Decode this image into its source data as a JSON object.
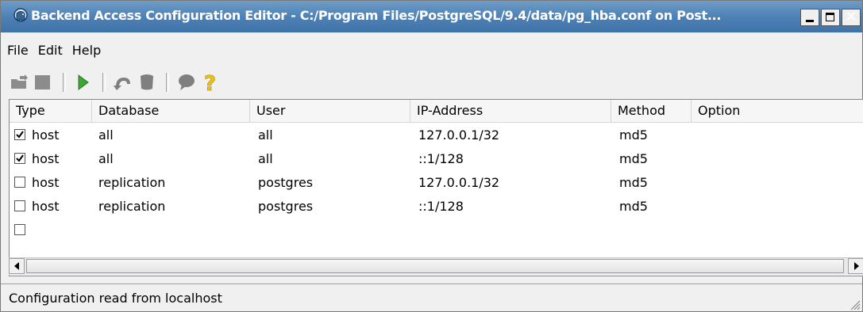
{
  "window": {
    "title": "Backend Access Configuration Editor - C:/Program Files/PostgreSQL/9.4/data/pg_hba.conf on Post..."
  },
  "menu": {
    "items": [
      "File",
      "Edit",
      "Help"
    ]
  },
  "toolbar": {
    "buttons": [
      "open-icon",
      "save-icon",
      "run-icon",
      "undo-icon",
      "delete-icon",
      "hint-icon",
      "help-icon"
    ]
  },
  "table": {
    "columns": [
      "Type",
      "Database",
      "User",
      "IP-Address",
      "Method",
      "Option"
    ],
    "rows": [
      {
        "checked": true,
        "type": "host",
        "database": "all",
        "user": "all",
        "ip": "127.0.0.1/32",
        "method": "md5",
        "option": ""
      },
      {
        "checked": true,
        "type": "host",
        "database": "all",
        "user": "all",
        "ip": "::1/128",
        "method": "md5",
        "option": ""
      },
      {
        "checked": false,
        "type": "host",
        "database": "replication",
        "user": "postgres",
        "ip": "127.0.0.1/32",
        "method": "md5",
        "option": ""
      },
      {
        "checked": false,
        "type": "host",
        "database": "replication",
        "user": "postgres",
        "ip": "::1/128",
        "method": "md5",
        "option": ""
      },
      {
        "checked": false,
        "type": "",
        "database": "",
        "user": "",
        "ip": "",
        "method": "",
        "option": ""
      }
    ]
  },
  "status": {
    "text": "Configuration read from localhost"
  },
  "colors": {
    "titlebar": "#4e82b6",
    "run_green": "#3fa535",
    "help_yellow": "#e8c31b",
    "icon_gray": "#7f7f7f"
  }
}
